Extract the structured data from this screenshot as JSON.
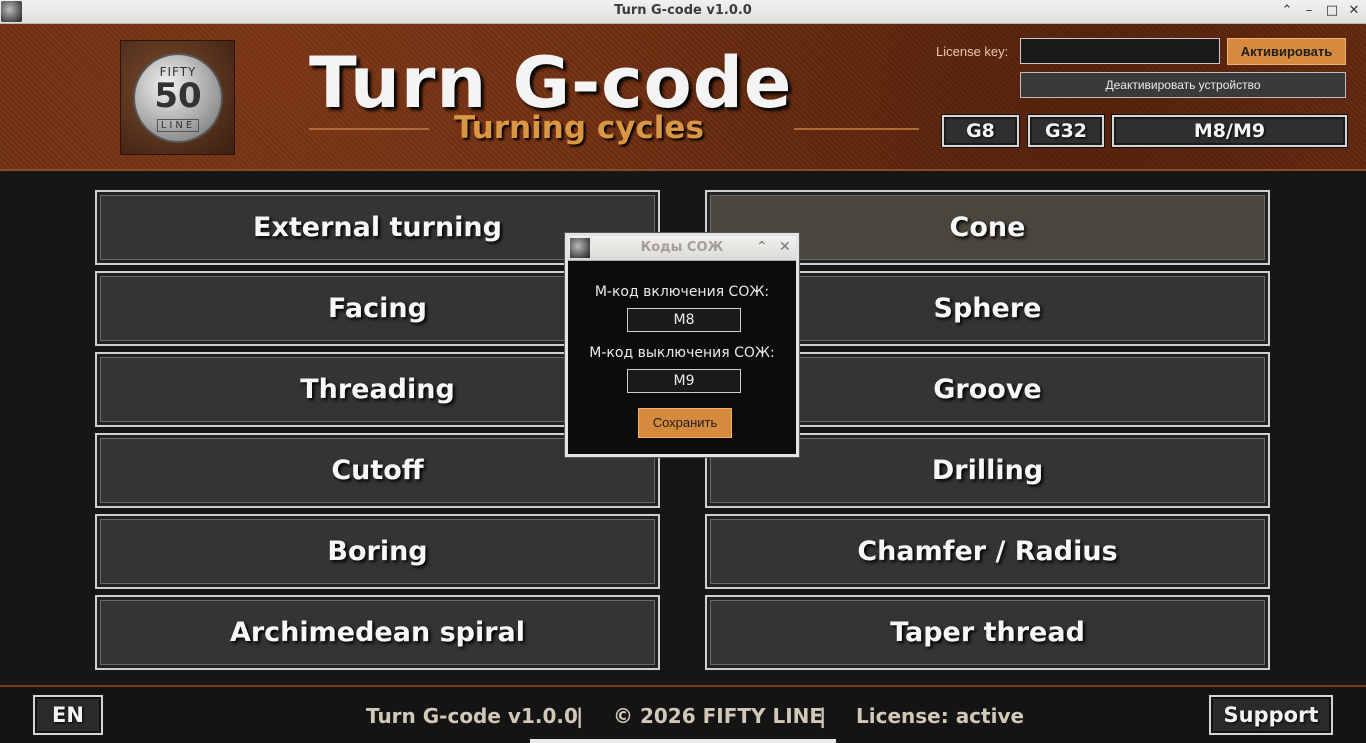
{
  "window": {
    "title": "Turn G-code v1.0.0"
  },
  "header": {
    "logo": {
      "top_text": "FIFTY",
      "number": "50",
      "bottom_text": "LINE"
    },
    "title": "Turn G-code",
    "subtitle": "Turning cycles",
    "license_label": "License key:",
    "license_value": "",
    "activate_label": "Активировать",
    "deactivate_label": "Деактивировать устройство",
    "code_buttons": [
      "G8",
      "G32",
      "M8/M9"
    ]
  },
  "cycles": {
    "left": [
      "External turning",
      "Facing",
      "Threading",
      "Cutoff",
      "Boring",
      "Archimedean spiral"
    ],
    "right": [
      "Cone",
      "Sphere",
      "Groove",
      "Drilling",
      "Chamfer / Radius",
      "Taper thread"
    ]
  },
  "footer": {
    "language": "EN",
    "app_version": "Turn G-code v1.0.0",
    "separator": "|",
    "copyright": "© 2026 FIFTY LINE",
    "license_status": "License: active",
    "support_label": "Support"
  },
  "dialog": {
    "title": "Коды СОЖ",
    "on_label": "М-код включения СОЖ:",
    "on_value": "M8",
    "off_label": "М-код выключения СОЖ:",
    "off_value": "M9",
    "save_label": "Сохранить"
  },
  "colors": {
    "accent": "#d68a3d",
    "header_bg": "#6e2e11",
    "main_bg": "#161616"
  }
}
